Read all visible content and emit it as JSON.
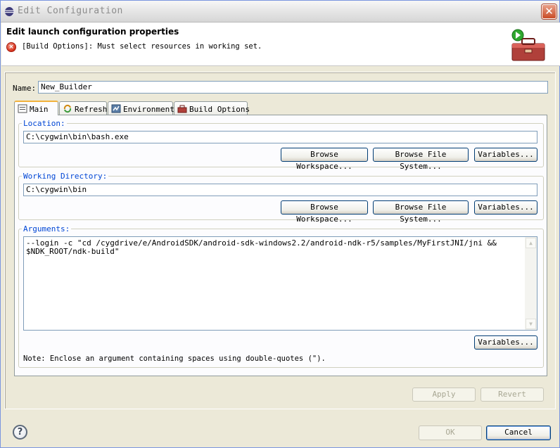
{
  "window": {
    "title": "Edit Configuration",
    "close_glyph": "✕"
  },
  "header": {
    "title": "Edit launch configuration properties",
    "error_message": "[Build Options]: Must select resources in working set.",
    "error_icon": "error-icon",
    "banner_icon": "toolbox-run-icon"
  },
  "name": {
    "label": "Name:",
    "value": "New_Builder"
  },
  "tabs": [
    {
      "label": "Main",
      "icon": "main-tab-icon",
      "active": true
    },
    {
      "label": "Refresh",
      "icon": "refresh-icon",
      "active": false
    },
    {
      "label": "Environment",
      "icon": "environment-icon",
      "active": false
    },
    {
      "label": "Build Options",
      "icon": "build-options-icon",
      "active": false
    }
  ],
  "location": {
    "label": "Location:",
    "value": "C:\\cygwin\\bin\\bash.exe",
    "browse_workspace": "Browse Workspace...",
    "browse_file_system": "Browse File System...",
    "variables": "Variables..."
  },
  "working_directory": {
    "label": "Working Directory:",
    "value": "C:\\cygwin\\bin",
    "browse_workspace": "Browse Workspace...",
    "browse_file_system": "Browse File System...",
    "variables": "Variables..."
  },
  "arguments": {
    "label": "Arguments:",
    "value": "--login -c \"cd /cygdrive/e/AndroidSDK/android-sdk-windows2.2/android-ndk-r5/samples/MyFirstJNI/jni &&\n$NDK_ROOT/ndk-build\"",
    "variables": "Variables...",
    "note": "Note: Enclose an argument containing spaces using double-quotes (\")."
  },
  "actions": {
    "apply": "Apply",
    "revert": "Revert",
    "ok": "OK",
    "cancel": "Cancel"
  },
  "colors": {
    "group_label": "#0046d5",
    "active_tab_accent": "#f2b23c",
    "error": "#d6301b"
  }
}
